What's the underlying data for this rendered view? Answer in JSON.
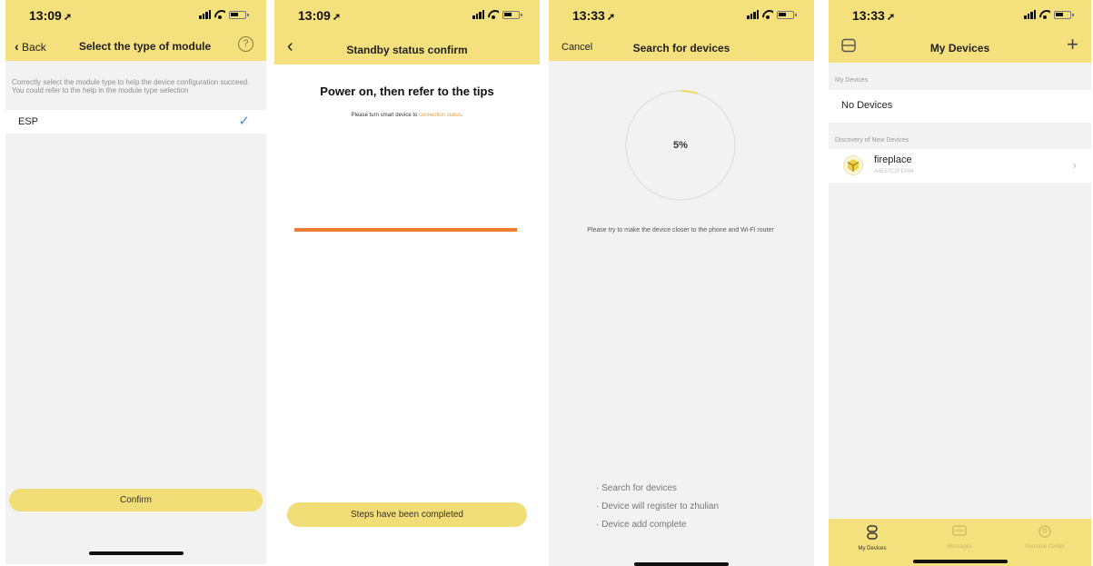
{
  "colors": {
    "accent": "#f4e07c",
    "check": "#4a8be0",
    "progress_line": "#ee7d32",
    "link_highlight": "#d9a442"
  },
  "panel1": {
    "time": "13:09",
    "back_label": "Back",
    "title": "Select the type of module",
    "hint": "Correctly select the module type to help the device configuration succeed. You could refer to the help in the module type selection",
    "module_option": "ESP",
    "confirm_label": "Confirm",
    "icons": [
      "location-arrow-icon",
      "signal-icon",
      "wifi-icon",
      "battery-icon",
      "chevron-left-icon",
      "help-icon",
      "checkmark-icon"
    ]
  },
  "panel2": {
    "time": "13:09",
    "title": "Standby status confirm",
    "heading": "Power on, then refer to the tips",
    "tip_prefix": "Please turn smart device to ",
    "tip_link": "connection status",
    "tip_suffix": ".",
    "complete_label": "Steps have been completed"
  },
  "panel3": {
    "time": "13:33",
    "cancel_label": "Cancel",
    "title": "Search for devices",
    "progress_percent": 5,
    "progress_text": "5%",
    "tip": "Please try to make the device closer to the phone and Wi-Fi router",
    "steps": [
      "· Search for devices",
      "· Device will register to zhulian",
      "· Device add complete"
    ]
  },
  "panel4": {
    "time": "13:33",
    "title": "My Devices",
    "my_devices_section": "My Devices",
    "no_devices": "No Devices",
    "discovery_section": "Discovery of New Devices",
    "device_name": "fireplace",
    "device_id": "A4E57C2FE894",
    "tabs": [
      {
        "label": "My Devices",
        "icon": "devices-tab-icon",
        "active": true
      },
      {
        "label": "Messages",
        "icon": "message-tab-icon",
        "active": false
      },
      {
        "label": "Personal Center",
        "icon": "person-tab-icon",
        "active": false
      }
    ]
  }
}
